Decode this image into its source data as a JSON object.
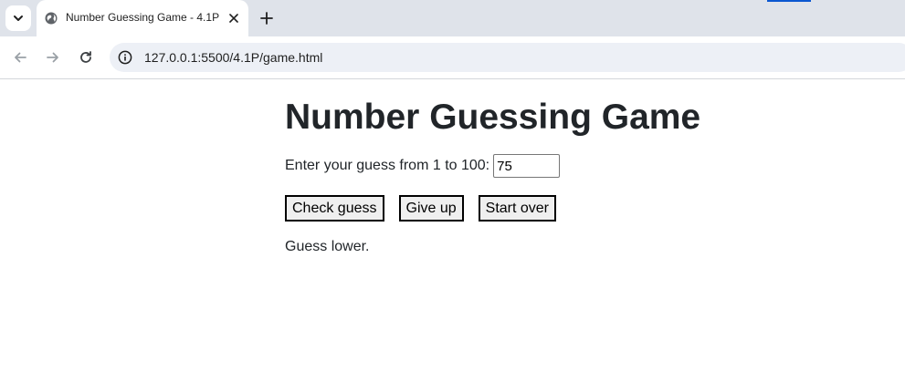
{
  "browser": {
    "tab": {
      "title": "Number Guessing Game - 4.1P",
      "favicon": "globe-icon"
    },
    "new_tab_label": "+",
    "address_bar": {
      "url": "127.0.0.1:5500/4.1P/game.html"
    },
    "accent_color": "#0b57d0"
  },
  "page": {
    "title": "Number Guessing Game",
    "guess_label": "Enter your guess from 1 to 100:",
    "guess_value": "75",
    "buttons": {
      "check": "Check guess",
      "give_up": "Give up",
      "start_over": "Start over"
    },
    "result": "Guess lower."
  },
  "colors": {
    "tabstrip_bg": "#dfe3ea",
    "omnibox_bg": "#edf0f6",
    "text": "#212529"
  }
}
